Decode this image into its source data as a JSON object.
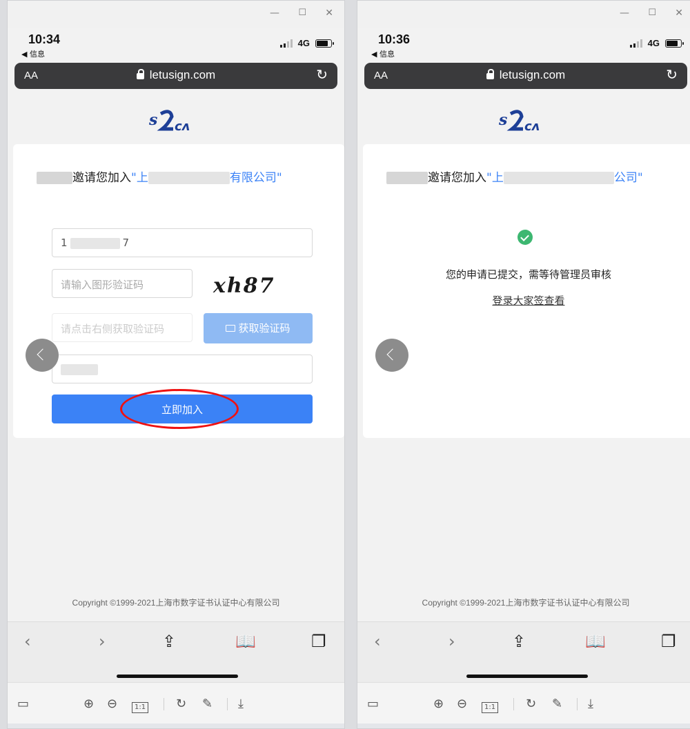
{
  "window": {
    "min_icon": "minimize-icon",
    "max_icon": "maximize-icon",
    "close_icon": "close-icon"
  },
  "left": {
    "status": {
      "time": "10:34",
      "back_label": "◀ 信息",
      "network": "4G"
    },
    "browser": {
      "aa": "AA",
      "url": "letusign.com"
    },
    "invite": {
      "text_mid": "邀请您加入",
      "quote_open": "\"上",
      "company_suffix": "有限公司\""
    },
    "form": {
      "phone_start": "1",
      "phone_end": "7",
      "captcha_placeholder": "请输入图形验证码",
      "captcha_image_text": "xh87",
      "sms_placeholder": "请点击右侧获取验证码",
      "sms_button": "获取验证码",
      "join_button": "立即加入"
    },
    "copyright": "Copyright ©1999-2021上海市数字证书认证中心有限公司"
  },
  "right": {
    "status": {
      "time": "10:36",
      "back_label": "◀ 信息",
      "network": "4G"
    },
    "browser": {
      "aa": "AA",
      "url": "letusign.com"
    },
    "invite": {
      "text_mid": "邀请您加入",
      "quote_open": "\"上",
      "company_suffix": "公司\""
    },
    "result": {
      "message": "您的申请已提交，需等待管理员审核",
      "login_link": "登录大家签查看"
    },
    "copyright": "Copyright ©1999-2021上海市数字证书认证中心有限公司"
  },
  "icons": {
    "lock": "lock-icon",
    "reload": "reload-icon",
    "back": "chevron-left-icon",
    "forward": "chevron-right-icon",
    "share": "share-icon",
    "bookmarks": "book-icon",
    "tabs": "tabs-icon"
  },
  "viewer_toolbar": {
    "one_to_one": "1:1"
  },
  "colors": {
    "primary": "#3b82f6",
    "primary_disabled": "#8fbaf3",
    "success": "#3db771",
    "highlight": "#e11111"
  }
}
